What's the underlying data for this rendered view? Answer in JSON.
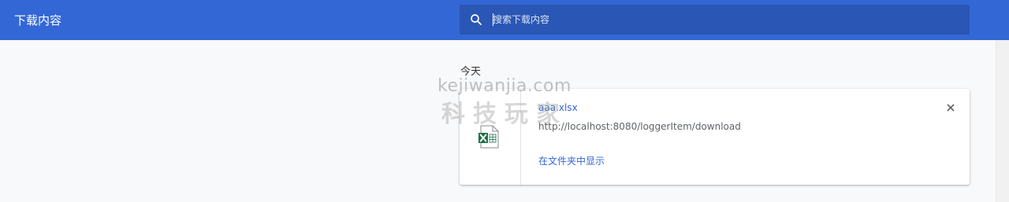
{
  "toolbar": {
    "title": "下载内容",
    "search": {
      "placeholder": "搜索下载内容",
      "value": ""
    }
  },
  "downloads": {
    "date_header": "今天",
    "items": [
      {
        "file_name": "aaa.xlsx",
        "url": "http://localhost:8080/loggerItem/download",
        "action_label": "在文件夹中显示",
        "file_type_icon": "excel-file-icon"
      }
    ]
  },
  "watermark": {
    "line1": "kejiwanjia.com",
    "line2": "科技玩家"
  },
  "colors": {
    "toolbar_bg": "#3367d6",
    "search_bg": "#2a56b5",
    "link": "#3367d6",
    "excel_green": "#1e7145"
  }
}
